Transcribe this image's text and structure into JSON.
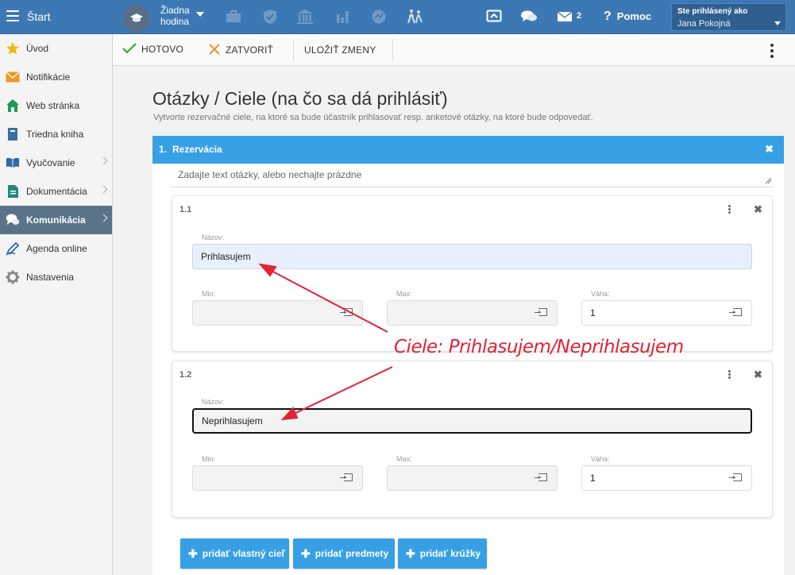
{
  "topbar": {
    "start_label": "Štart",
    "hour_label": "Žiadna hodina",
    "mail_count": "2",
    "help_label": "Pomoc",
    "user_line1": "Ste prihlásený ako",
    "user_line2": "Jana Pokojná"
  },
  "sidebar": {
    "items": [
      {
        "label": "Úvod",
        "icon": "star-icon"
      },
      {
        "label": "Notifikácie",
        "icon": "envelope-icon"
      },
      {
        "label": "Web stránka",
        "icon": "home-icon"
      },
      {
        "label": "Triedna kniha",
        "icon": "book-icon"
      },
      {
        "label": "Vyučovanie",
        "icon": "open-book-icon"
      },
      {
        "label": "Dokumentácia",
        "icon": "document-icon"
      },
      {
        "label": "Komunikácia",
        "icon": "chat-icon",
        "active": true
      },
      {
        "label": "Agenda online",
        "icon": "pencil-icon"
      },
      {
        "label": "Nastavenia",
        "icon": "gear-icon"
      }
    ]
  },
  "toolbar": {
    "done_label": "HOTOVO",
    "close_label": "ZATVORIŤ",
    "save_label": "ULOŽIŤ ZMENY"
  },
  "page": {
    "title": "Otázky / Ciele (na čo sa dá prihlásiť)",
    "subtitle": "Vytvorte rezervačné ciele, na ktoré sa bude účastník prihlasovať resp. anketové otázky, na ktoré bude odpovedať."
  },
  "question": {
    "number": "1.",
    "title": "Rezervácia",
    "text_placeholder": "Zadajte text otázky, alebo nechajte prázdne",
    "goals": [
      {
        "number": "1.1",
        "name_label": "Názov:",
        "name_value": "Prihlasujem",
        "min_label": "Min:",
        "min_value": "",
        "max_label": "Max:",
        "max_value": "",
        "weight_label": "Váha:",
        "weight_value": "1"
      },
      {
        "number": "1.2",
        "name_label": "Názov:",
        "name_value": "Neprihlasujem",
        "min_label": "Min:",
        "min_value": "",
        "max_label": "Max:",
        "max_value": "",
        "weight_label": "Váha:",
        "weight_value": "1"
      }
    ]
  },
  "buttons": {
    "add_own_goal": "pridať vlastný cieľ",
    "add_subjects": "pridať predmety",
    "add_clubs": "pridať krúžky"
  },
  "annotation": {
    "text": "Ciele: Prihlasujem/Neprihlasujem",
    "color": "#e22235"
  },
  "colors": {
    "topbar": "#3c79b4",
    "accent": "#37a0e4",
    "sidebar_active": "#5a7389"
  }
}
